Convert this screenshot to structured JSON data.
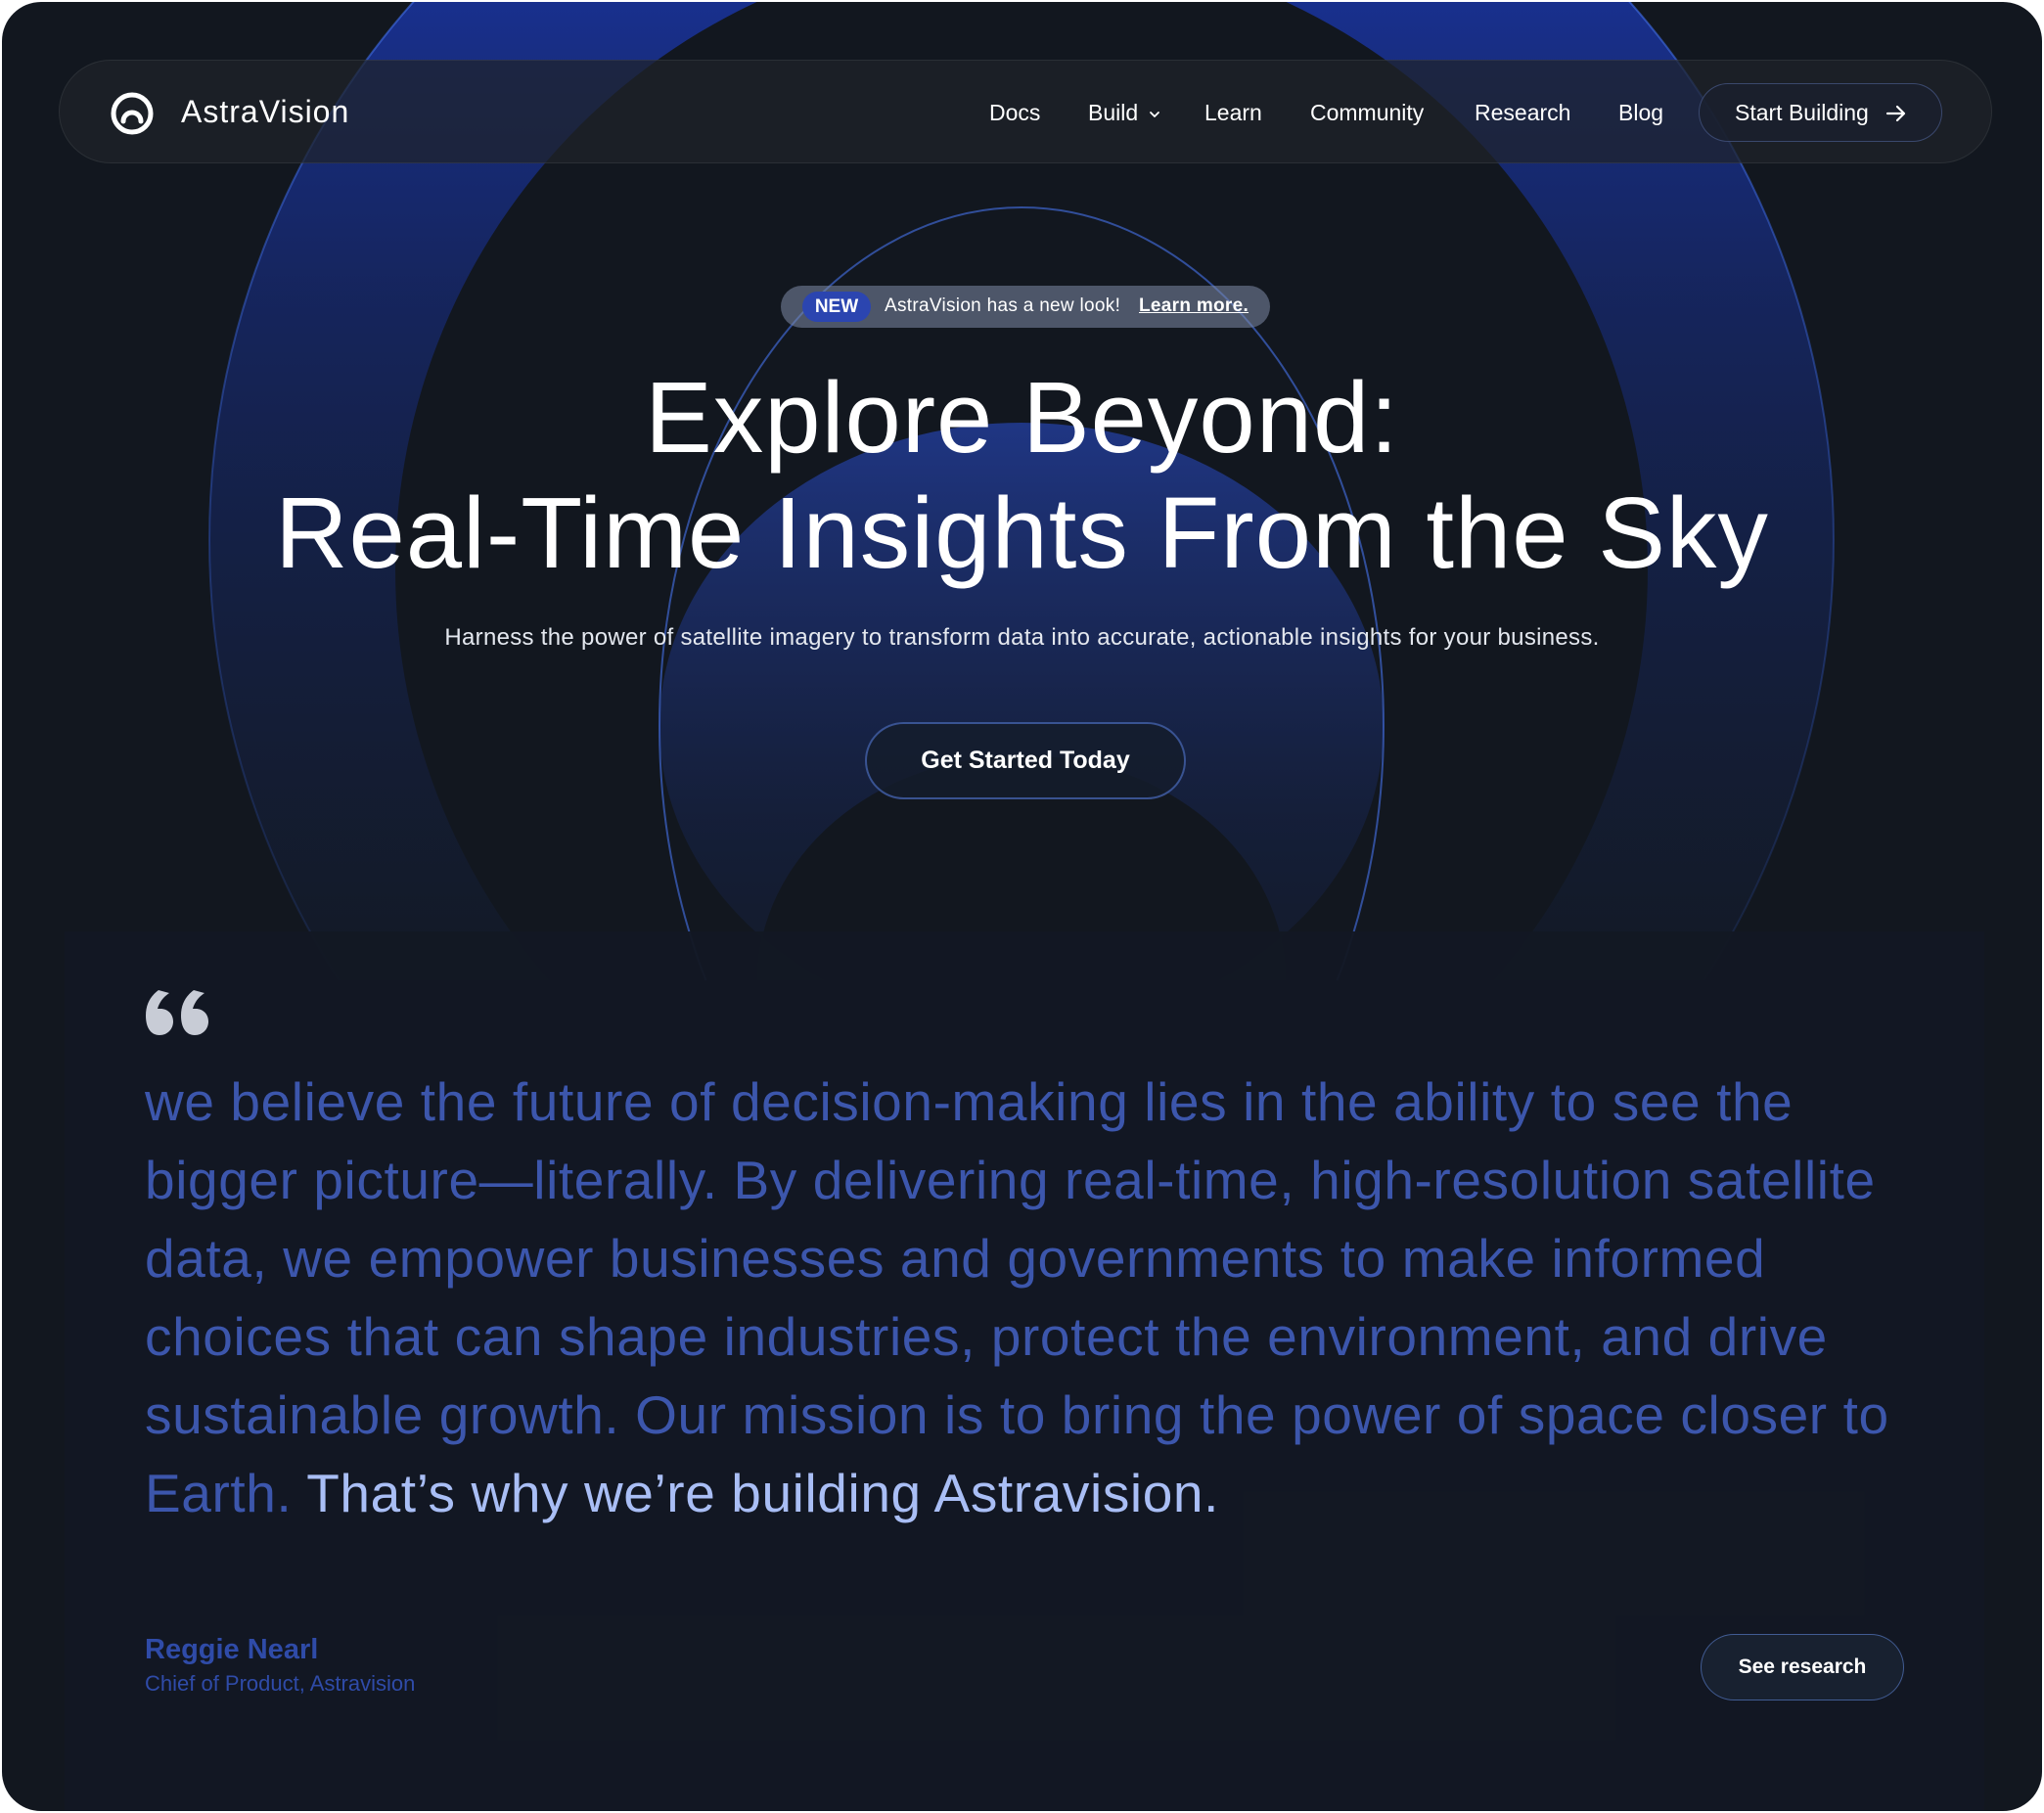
{
  "nav": {
    "brand": "AstraVision",
    "logo_icon": "ring-logo-icon",
    "items": [
      {
        "label": "Docs"
      },
      {
        "label": "Build",
        "has_dropdown": true,
        "icon": "chevron-down-icon"
      },
      {
        "label": "Learn"
      },
      {
        "label": "Community"
      },
      {
        "label": "Research"
      },
      {
        "label": "Blog"
      }
    ],
    "cta": {
      "label": "Start Building",
      "icon": "arrow-right-icon"
    }
  },
  "announcement": {
    "badge": "NEW",
    "message": "AstraVision has a new look!",
    "link": "Learn more."
  },
  "hero": {
    "title_line1": "Explore Beyond:",
    "title_line2": "Real-Time Insights From the Sky",
    "subtitle": "Harness the power of satellite imagery to transform data into accurate, actionable insights for your business.",
    "cta": "Get Started Today"
  },
  "testimonial": {
    "quote_icon": "quote-mark-icon",
    "quote": "we believe the future of decision-making lies in the ability to see the bigger picture—literally. By delivering real-time, high-resolution satellite data, we empower businesses and governments to make informed choices that can shape industries, protect the environment, and drive sustainable growth. Our mission is to bring the power of space closer to Earth.",
    "quote_highlight": "That’s why we’re building Astravision.",
    "author_name": "Reggie Nearl",
    "author_role": "Chief of Product, Astravision",
    "cta": "See research"
  },
  "colors": {
    "background": "#12171f",
    "accent_blue": "#2b45b0",
    "quote_text": "#3c56ac",
    "quote_highlight": "#a9bef5",
    "ring_blue": "#1f3fc0"
  }
}
